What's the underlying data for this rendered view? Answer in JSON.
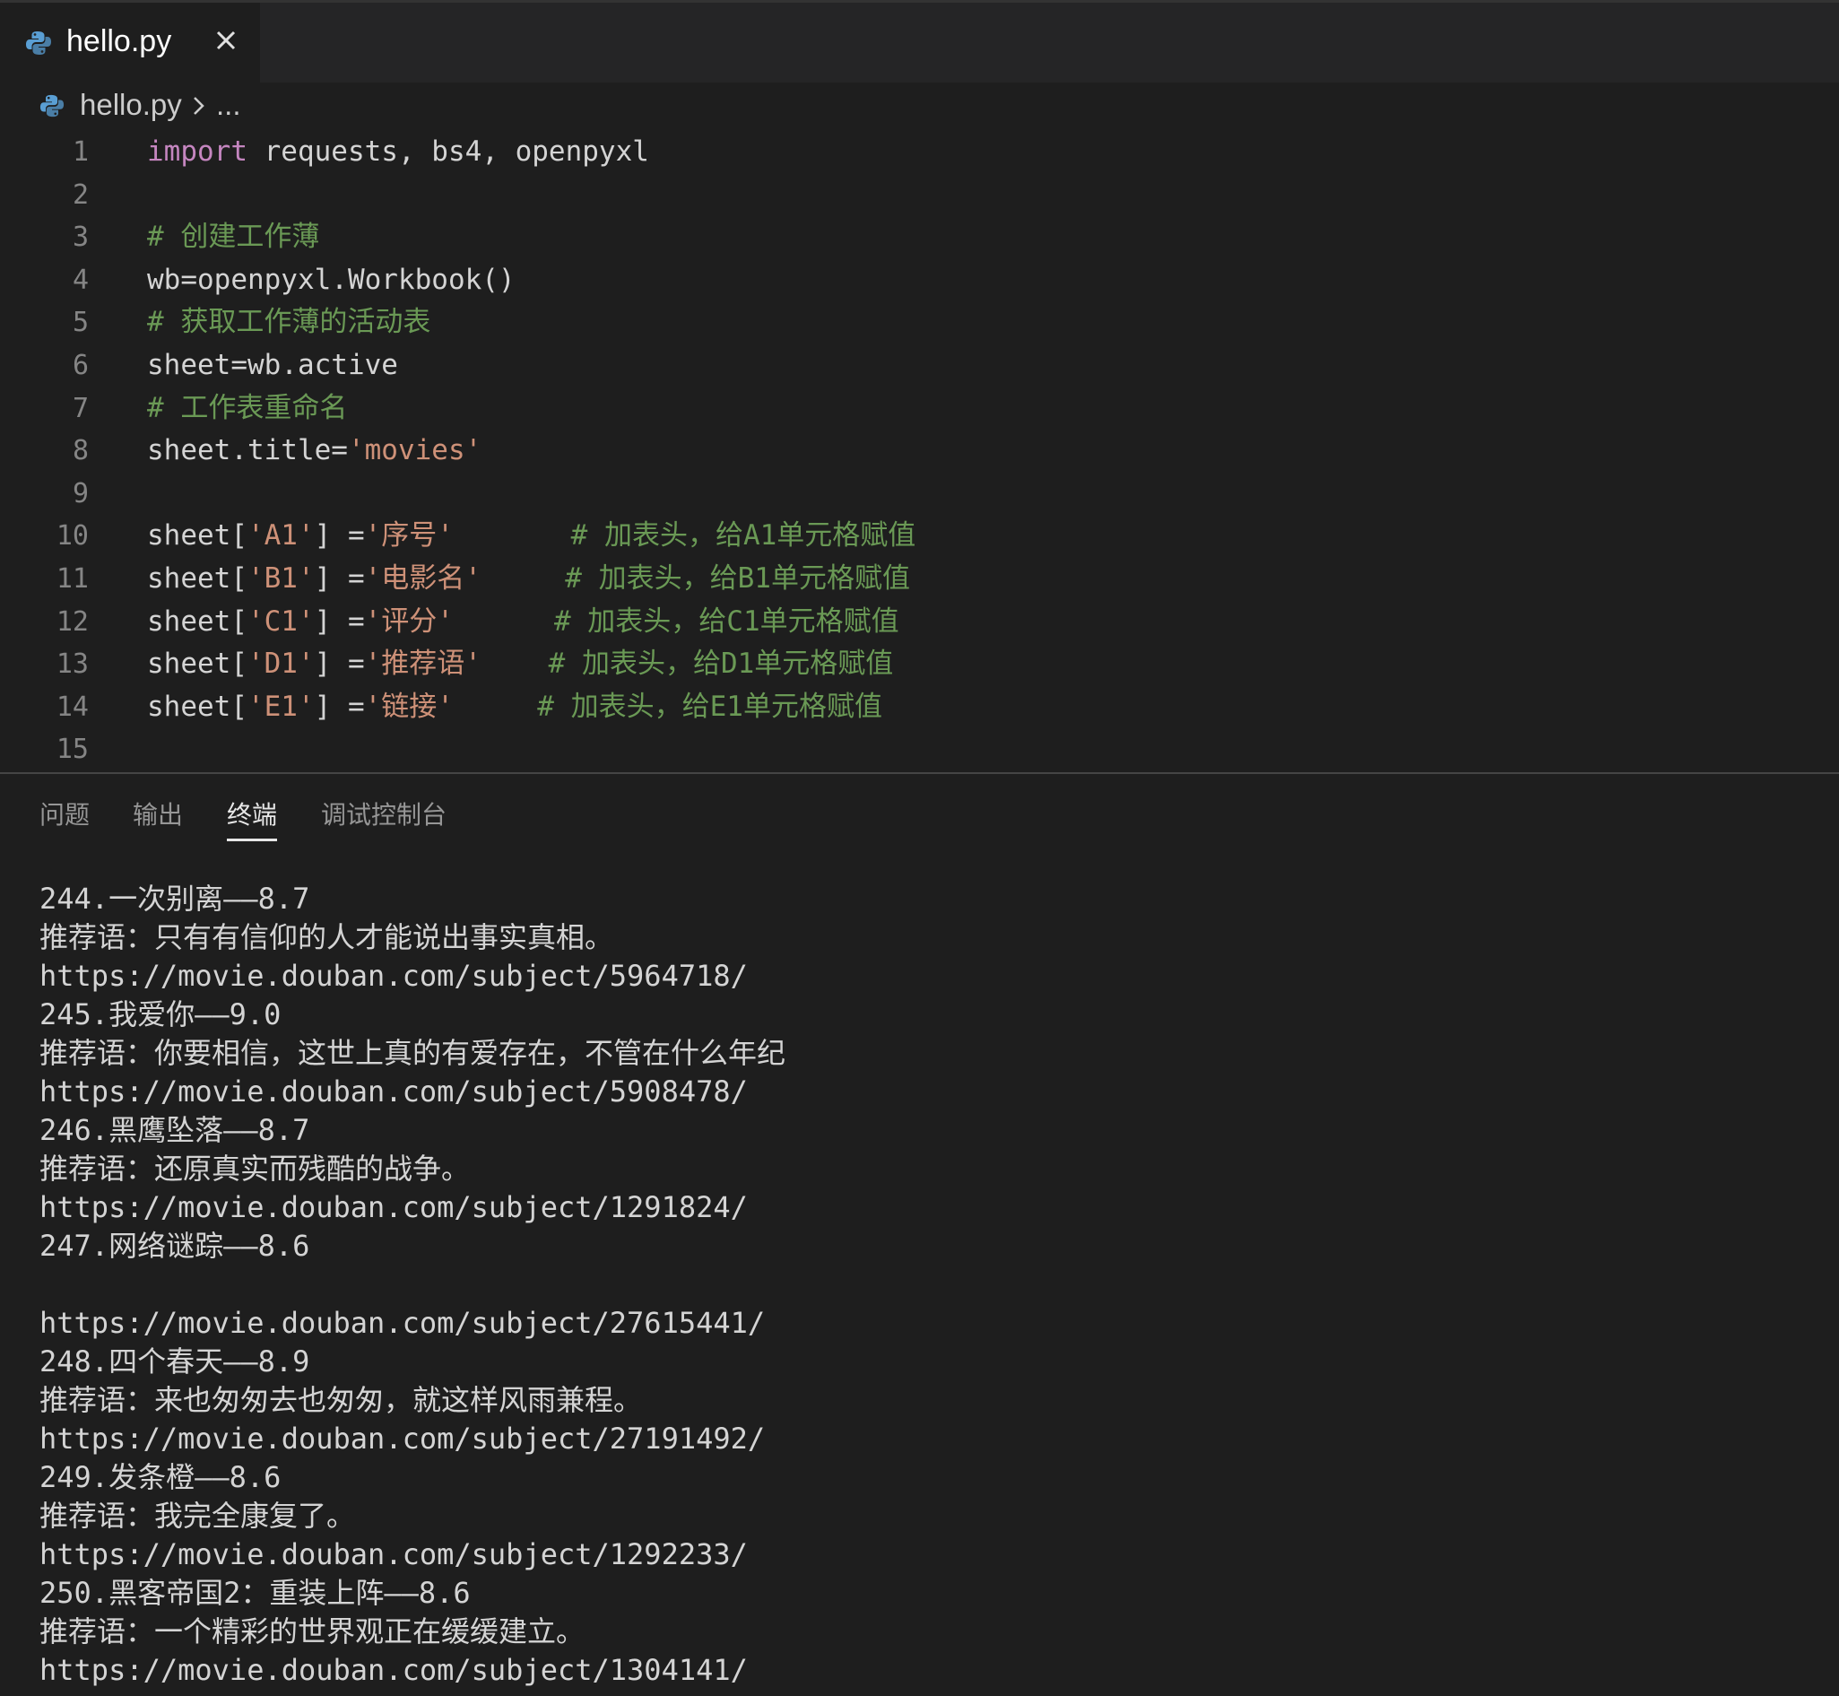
{
  "tab": {
    "label": "hello.py",
    "file_icon": "python-file-icon",
    "close_icon": "close-icon"
  },
  "breadcrumb": {
    "file": "hello.py",
    "separator_icon": "chevron-right-icon",
    "more": "..."
  },
  "editor": {
    "lines": [
      {
        "n": "1",
        "parts": [
          [
            "kw",
            "import"
          ],
          [
            "plain",
            " requests, bs4, openpyxl"
          ]
        ]
      },
      {
        "n": "2",
        "parts": []
      },
      {
        "n": "3",
        "parts": [
          [
            "cmt",
            "# 创建工作薄"
          ]
        ]
      },
      {
        "n": "4",
        "parts": [
          [
            "plain",
            "wb=openpyxl.Workbook()"
          ]
        ]
      },
      {
        "n": "5",
        "parts": [
          [
            "cmt",
            "# 获取工作薄的活动表"
          ]
        ]
      },
      {
        "n": "6",
        "parts": [
          [
            "plain",
            "sheet=wb.active"
          ]
        ]
      },
      {
        "n": "7",
        "parts": [
          [
            "cmt",
            "# 工作表重命名"
          ]
        ]
      },
      {
        "n": "8",
        "parts": [
          [
            "plain",
            "sheet.title="
          ],
          [
            "str",
            "'movies'"
          ]
        ]
      },
      {
        "n": "9",
        "parts": []
      },
      {
        "n": "10",
        "parts": [
          [
            "plain",
            "sheet["
          ],
          [
            "str",
            "'A1'"
          ],
          [
            "plain",
            "] ="
          ],
          [
            "str",
            "'序号'"
          ],
          [
            "plain",
            "       "
          ],
          [
            "cmt",
            "# 加表头，给A1单元格赋值"
          ]
        ]
      },
      {
        "n": "11",
        "parts": [
          [
            "plain",
            "sheet["
          ],
          [
            "str",
            "'B1'"
          ],
          [
            "plain",
            "] ="
          ],
          [
            "str",
            "'电影名'"
          ],
          [
            "plain",
            "     "
          ],
          [
            "cmt",
            "# 加表头，给B1单元格赋值"
          ]
        ]
      },
      {
        "n": "12",
        "parts": [
          [
            "plain",
            "sheet["
          ],
          [
            "str",
            "'C1'"
          ],
          [
            "plain",
            "] ="
          ],
          [
            "str",
            "'评分'"
          ],
          [
            "plain",
            "      "
          ],
          [
            "cmt",
            "# 加表头，给C1单元格赋值"
          ]
        ]
      },
      {
        "n": "13",
        "parts": [
          [
            "plain",
            "sheet["
          ],
          [
            "str",
            "'D1'"
          ],
          [
            "plain",
            "] ="
          ],
          [
            "str",
            "'推荐语'"
          ],
          [
            "plain",
            "    "
          ],
          [
            "cmt",
            "# 加表头，给D1单元格赋值"
          ]
        ]
      },
      {
        "n": "14",
        "parts": [
          [
            "plain",
            "sheet["
          ],
          [
            "str",
            "'E1'"
          ],
          [
            "plain",
            "] ="
          ],
          [
            "str",
            "'链接'"
          ],
          [
            "plain",
            "     "
          ],
          [
            "cmt",
            "# 加表头，给E1单元格赋值"
          ]
        ]
      },
      {
        "n": "15",
        "parts": []
      }
    ]
  },
  "panel": {
    "tabs": [
      {
        "label": "问题",
        "active": false
      },
      {
        "label": "输出",
        "active": false
      },
      {
        "label": "终端",
        "active": true
      },
      {
        "label": "调试控制台",
        "active": false
      }
    ]
  },
  "terminal": {
    "lines": [
      "244.一次别离——8.7",
      "推荐语：只有有信仰的人才能说出事实真相。",
      "https://movie.douban.com/subject/5964718/",
      "245.我爱你——9.0",
      "推荐语：你要相信，这世上真的有爱存在，不管在什么年纪",
      "https://movie.douban.com/subject/5908478/",
      "246.黑鹰坠落——8.7",
      "推荐语：还原真实而残酷的战争。",
      "https://movie.douban.com/subject/1291824/",
      "247.网络谜踪——8.6",
      "",
      "https://movie.douban.com/subject/27615441/",
      "248.四个春天——8.9",
      "推荐语：来也匆匆去也匆匆，就这样风雨兼程。",
      "https://movie.douban.com/subject/27191492/",
      "249.发条橙——8.6",
      "推荐语：我完全康复了。",
      "https://movie.douban.com/subject/1292233/",
      "250.黑客帝国2：重装上阵——8.6",
      "推荐语：一个精彩的世界观正在缓缓建立。",
      "https://movie.douban.com/subject/1304141/"
    ]
  },
  "colors": {
    "background": "#1e1e1e",
    "tab_strip": "#252526",
    "keyword": "#c586c0",
    "string": "#ce9178",
    "comment": "#6a9955",
    "text": "#d4d4d4",
    "line_number": "#858585"
  }
}
